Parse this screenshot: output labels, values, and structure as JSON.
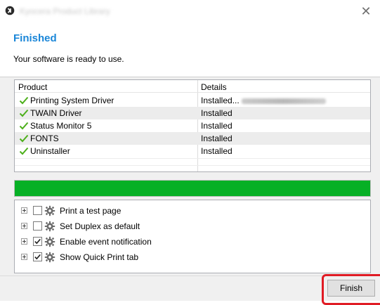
{
  "window": {
    "title": "Kyocera Product Library"
  },
  "header": {
    "heading": "Finished",
    "subtext": "Your software is ready to use."
  },
  "product_list": {
    "columns": [
      "Product",
      "Details"
    ],
    "rows": [
      {
        "product": "Printing System Driver",
        "details": "Installed..."
      },
      {
        "product": "TWAIN Driver",
        "details": "Installed"
      },
      {
        "product": "Status Monitor 5",
        "details": "Installed"
      },
      {
        "product": "FONTS",
        "details": "Installed"
      },
      {
        "product": "Uninstaller",
        "details": "Installed"
      }
    ]
  },
  "progress": {
    "fraction": 1.0,
    "color": "#06b025"
  },
  "options": [
    {
      "label": "Print a test page",
      "checked": false
    },
    {
      "label": "Set Duplex as default",
      "checked": false
    },
    {
      "label": "Enable event notification",
      "checked": true
    },
    {
      "label": "Show Quick Print tab",
      "checked": true
    }
  ],
  "buttons": {
    "finish_label": "Finish"
  },
  "colors": {
    "heading": "#1a86d8",
    "check": "#4caf1a",
    "highlight": "#e01b24"
  },
  "icons": {
    "app": "app-icon",
    "close": "close-icon",
    "check": "check-icon",
    "expand": "plus-icon",
    "option": "gear-icon"
  }
}
